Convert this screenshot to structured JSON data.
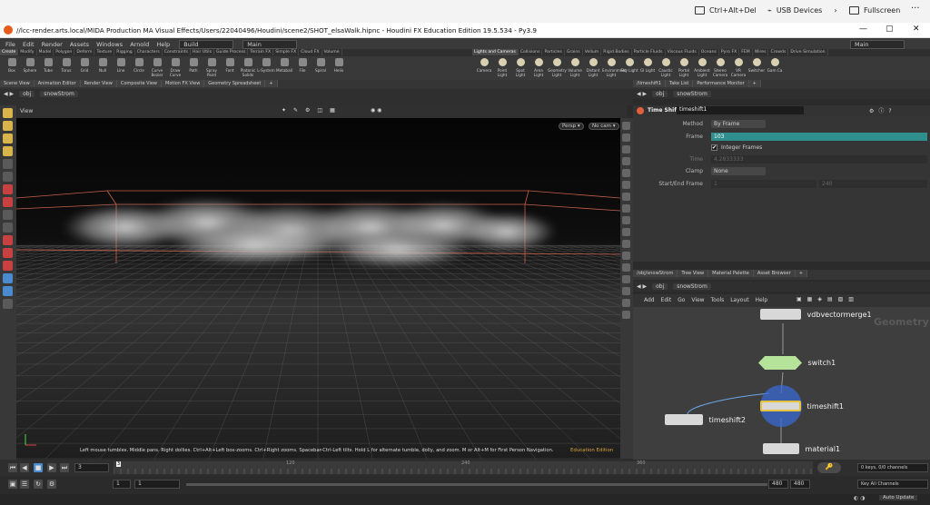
{
  "remote_bar": {
    "ctrl_alt_del": "Ctrl+Alt+Del",
    "usb": "USB Devices",
    "fullscreen": "Fullscreen",
    "more": "···"
  },
  "titlebar": {
    "title": "//lcc-render.arts.local/MIDA Production MA Visual Effects/Users/22040496/Houdini/scene2/SHOT_elsaWalk.hipnc - Houdini FX Education Edition 19.5.534 - Py3.9",
    "minimize": "—",
    "maximize": "▢",
    "close": "✕"
  },
  "menubar": {
    "items": [
      "File",
      "Edit",
      "Render",
      "Assets",
      "Windows",
      "Arnold",
      "Help"
    ],
    "build": "Build",
    "desktop": "Main",
    "right_desktop": "Main"
  },
  "shelf_left": {
    "tabs": [
      "Create",
      "Modify",
      "Model",
      "Polygon",
      "Deform",
      "Texture",
      "Rigging",
      "Characters",
      "Constraints",
      "Hair Utils",
      "Guide Process",
      "Terrain FX",
      "Simple FX",
      "Cloud FX",
      "Volume"
    ],
    "tools": [
      "Box",
      "Sphere",
      "Tube",
      "Torus",
      "Grid",
      "Null",
      "Line",
      "Circle",
      "Curve Bezier",
      "Draw Curve",
      "Path",
      "Spray Paint",
      "Font",
      "Platonic Solids",
      "L-System",
      "Metaball",
      "File",
      "Spiral",
      "Helix"
    ]
  },
  "shelf_right": {
    "tabs": [
      "Lights and Cameras",
      "Collisions",
      "Particles",
      "Grains",
      "Vellum",
      "Rigid Bodies",
      "Particle Fluids",
      "Viscous Fluids",
      "Oceans",
      "Pyro FX",
      "FEM",
      "Wires",
      "Crowds",
      "Drive Simulation"
    ],
    "tools": [
      "Camera",
      "Point Light",
      "Spot Light",
      "Area Light",
      "Geometry Light",
      "Volume Light",
      "Distant Light",
      "Environment Light",
      "Sky Light",
      "GI Light",
      "Caustic Light",
      "Portal Light",
      "Ambient Light",
      "Stereo Camera",
      "VR Camera",
      "Switcher",
      "Gam Ca"
    ]
  },
  "pane_tabs_left": [
    "Scene View",
    "Animation Editor",
    "Render View",
    "Composite View",
    "Motion FX View",
    "Geometry Spreadsheet"
  ],
  "pane_tabs_right": [
    "/timeshift1",
    "Take List",
    "Performance Monitor"
  ],
  "viewport": {
    "path": [
      "obj",
      "snowStrom"
    ],
    "label": "View",
    "persp": "Persp ▾",
    "nocam": "No cam ▾",
    "message": "Left mouse tumbles. Middle pans. Right dollies. Ctrl+Alt+Left box-zooms. Ctrl+Right zooms. Spacebar-Ctrl-Left tilts. Hold L for alternate tumble, dolly, and zoom.    M or Alt+M for First Person Navigation.",
    "edition": "Education Edition"
  },
  "params": {
    "path": [
      "obj",
      "snowStrom"
    ],
    "node_type": "Time Shift",
    "node_name": "timeshift1",
    "method_label": "Method",
    "method_value": "By Frame",
    "frame_label": "Frame",
    "frame_value": "103",
    "integer_label": "Integer Frames",
    "time_label": "Time",
    "time_value": "4.2833333",
    "clamp_label": "Clamp",
    "clamp_value": "None",
    "range_label": "Start/End Frame",
    "range_start": "1",
    "range_end": "240"
  },
  "network": {
    "tabs": [
      "/obj/snowStrom",
      "Tree View",
      "Material Palette",
      "Asset Browser"
    ],
    "path": [
      "obj",
      "snowStrom"
    ],
    "menu": [
      "Add",
      "Edit",
      "Go",
      "View",
      "Tools",
      "Layout",
      "Help"
    ],
    "context_label": "Geometry",
    "nodes": {
      "n1": "vdbvectormerge1",
      "n2": "switch1",
      "n3": "timeshift1",
      "n4": "timeshift2",
      "n5": "material1"
    }
  },
  "timeline": {
    "current_frame": "3",
    "ticks": [
      "120",
      "240",
      "360"
    ],
    "start": "1",
    "start2": "1",
    "end": "480",
    "end2": "480",
    "keys": "0 keys, 0/0 channels",
    "key_all": "Key All Channels"
  },
  "status": {
    "auto_update": "Auto Update"
  },
  "colors": {
    "accent_teal": "#2f8f8c",
    "bbox": "#c8604a",
    "node_green": "#b6e39a"
  }
}
